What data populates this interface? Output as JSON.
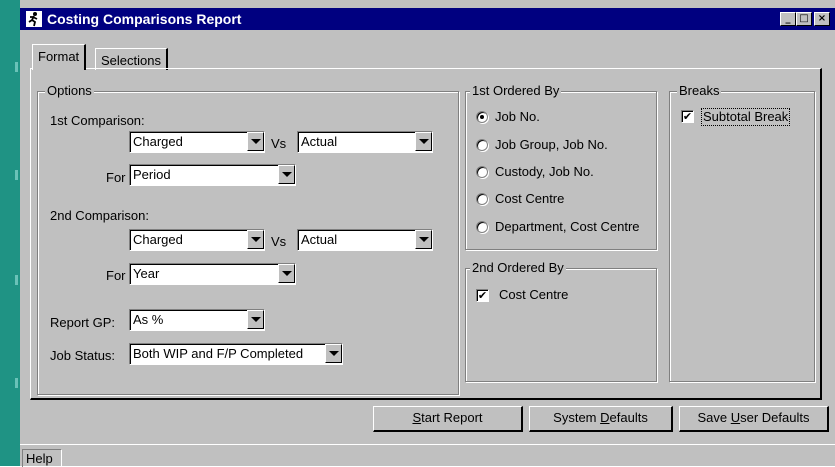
{
  "window": {
    "title": "Costing Comparisons Report",
    "controls": {
      "minimize": "_",
      "maximize": "□",
      "close": "×"
    }
  },
  "tabs": [
    {
      "label": "Format",
      "active": true
    },
    {
      "label": "Selections",
      "active": false
    }
  ],
  "options": {
    "label": "Options",
    "comparison1": {
      "label": "1st Comparison:",
      "left": "Charged",
      "vs": "Vs",
      "right": "Actual",
      "for_label": "For",
      "for_value": "Period"
    },
    "comparison2": {
      "label": "2nd Comparison:",
      "left": "Charged",
      "vs": "Vs",
      "right": "Actual",
      "for_label": "For",
      "for_value": "Year"
    },
    "report_gp": {
      "label": "Report GP:",
      "value": "As %"
    },
    "job_status": {
      "label": "Job Status:",
      "value": "Both WIP and F/P Completed"
    }
  },
  "ordered1": {
    "label": "1st Ordered By",
    "items": [
      {
        "label": "Job No.",
        "selected": true
      },
      {
        "label": "Job Group, Job No.",
        "selected": false
      },
      {
        "label": "Custody, Job No.",
        "selected": false
      },
      {
        "label": "Cost Centre",
        "selected": false
      },
      {
        "label": "Department, Cost Centre",
        "selected": false
      }
    ]
  },
  "ordered2": {
    "label": "2nd Ordered By",
    "check_label": "Cost Centre",
    "checked": true
  },
  "breaks": {
    "label": "Breaks",
    "check_label": "Subtotal Break",
    "checked": true
  },
  "buttons": {
    "start_pre": "",
    "start_u": "S",
    "start_post": "tart Report",
    "sysdef_pre": "System ",
    "sysdef_u": "D",
    "sysdef_post": "efaults",
    "userdef_pre": "Save ",
    "userdef_u": "U",
    "userdef_post": "ser Defaults"
  },
  "status": {
    "help": "Help"
  },
  "glyphs": {
    "check": "✔",
    "app_icon": "runner-icon"
  }
}
